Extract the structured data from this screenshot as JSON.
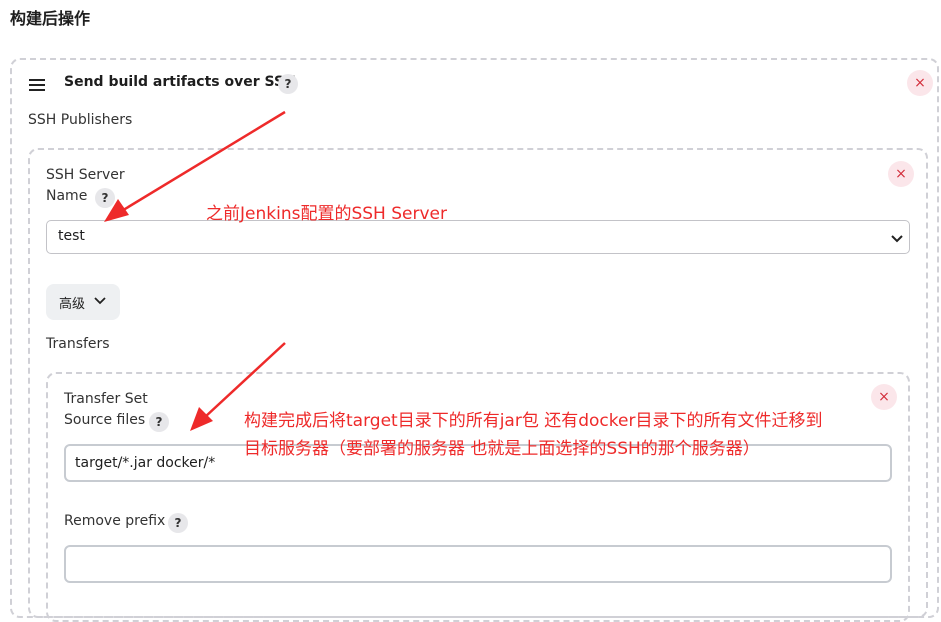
{
  "section": {
    "title": "构建后操作"
  },
  "step": {
    "title": "Send build artifacts over SSH",
    "help_glyph": "?",
    "close_glyph": "×"
  },
  "ssh_publishers": {
    "label": "SSH Publishers",
    "server": {
      "label_line1": "SSH Server",
      "label_line2": "Name",
      "selected": "test",
      "close_glyph": "×"
    },
    "advanced": {
      "label": "高级"
    },
    "transfers": {
      "label": "Transfers",
      "transfer_set": {
        "title": "Transfer Set",
        "source_files_label": "Source files",
        "source_files_value": "target/*.jar docker/*",
        "remove_prefix_label": "Remove prefix",
        "remove_prefix_value": "",
        "close_glyph": "×"
      }
    }
  },
  "annotations": {
    "server_note": "之前Jenkins配置的SSH Server",
    "transfer_note_line1": "构建完成后将target目录下的所有jar包 还有docker目录下的所有文件迁移到",
    "transfer_note_line2": "目标服务器（要部署的服务器 也就是上面选择的SSH的那个服务器）",
    "color": "#ee2a2a"
  },
  "icons": [
    "drag-handle-icon",
    "help-icon",
    "close-icon",
    "chevron-down-icon",
    "arrow-annotation"
  ]
}
